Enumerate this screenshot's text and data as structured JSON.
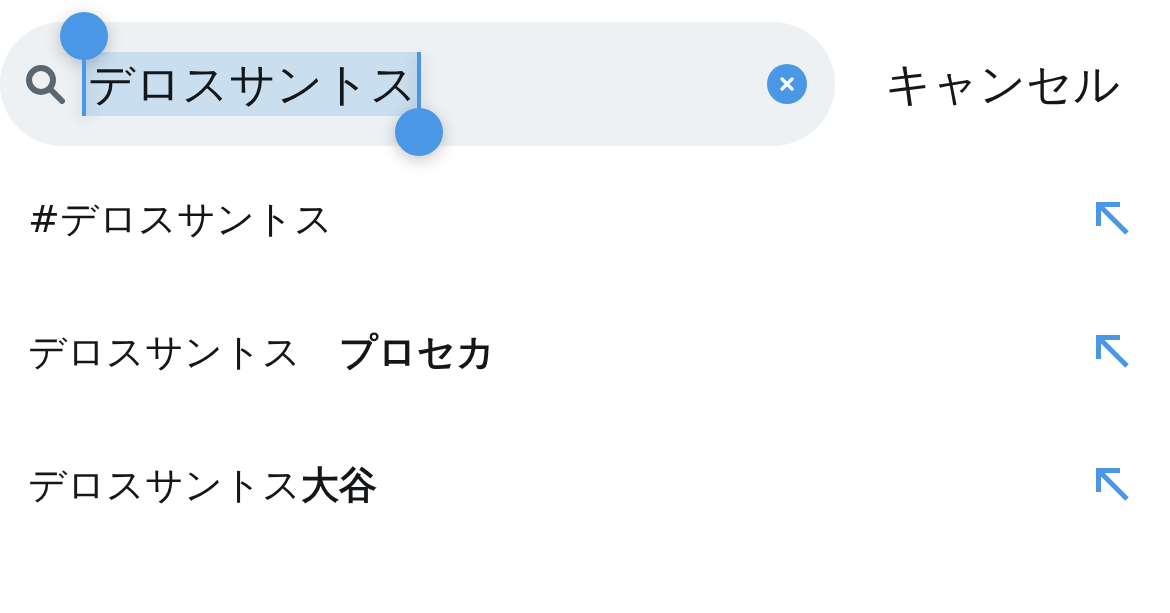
{
  "search": {
    "value": "デロスサントス",
    "text_selected": true
  },
  "cancel_button": {
    "label": "キャンセル"
  },
  "suggestions": [
    {
      "text": "#デロスサントス"
    },
    {
      "text": "デロスサントス　**プロセカ**"
    },
    {
      "text": "デロスサントス**大谷**"
    }
  ]
}
